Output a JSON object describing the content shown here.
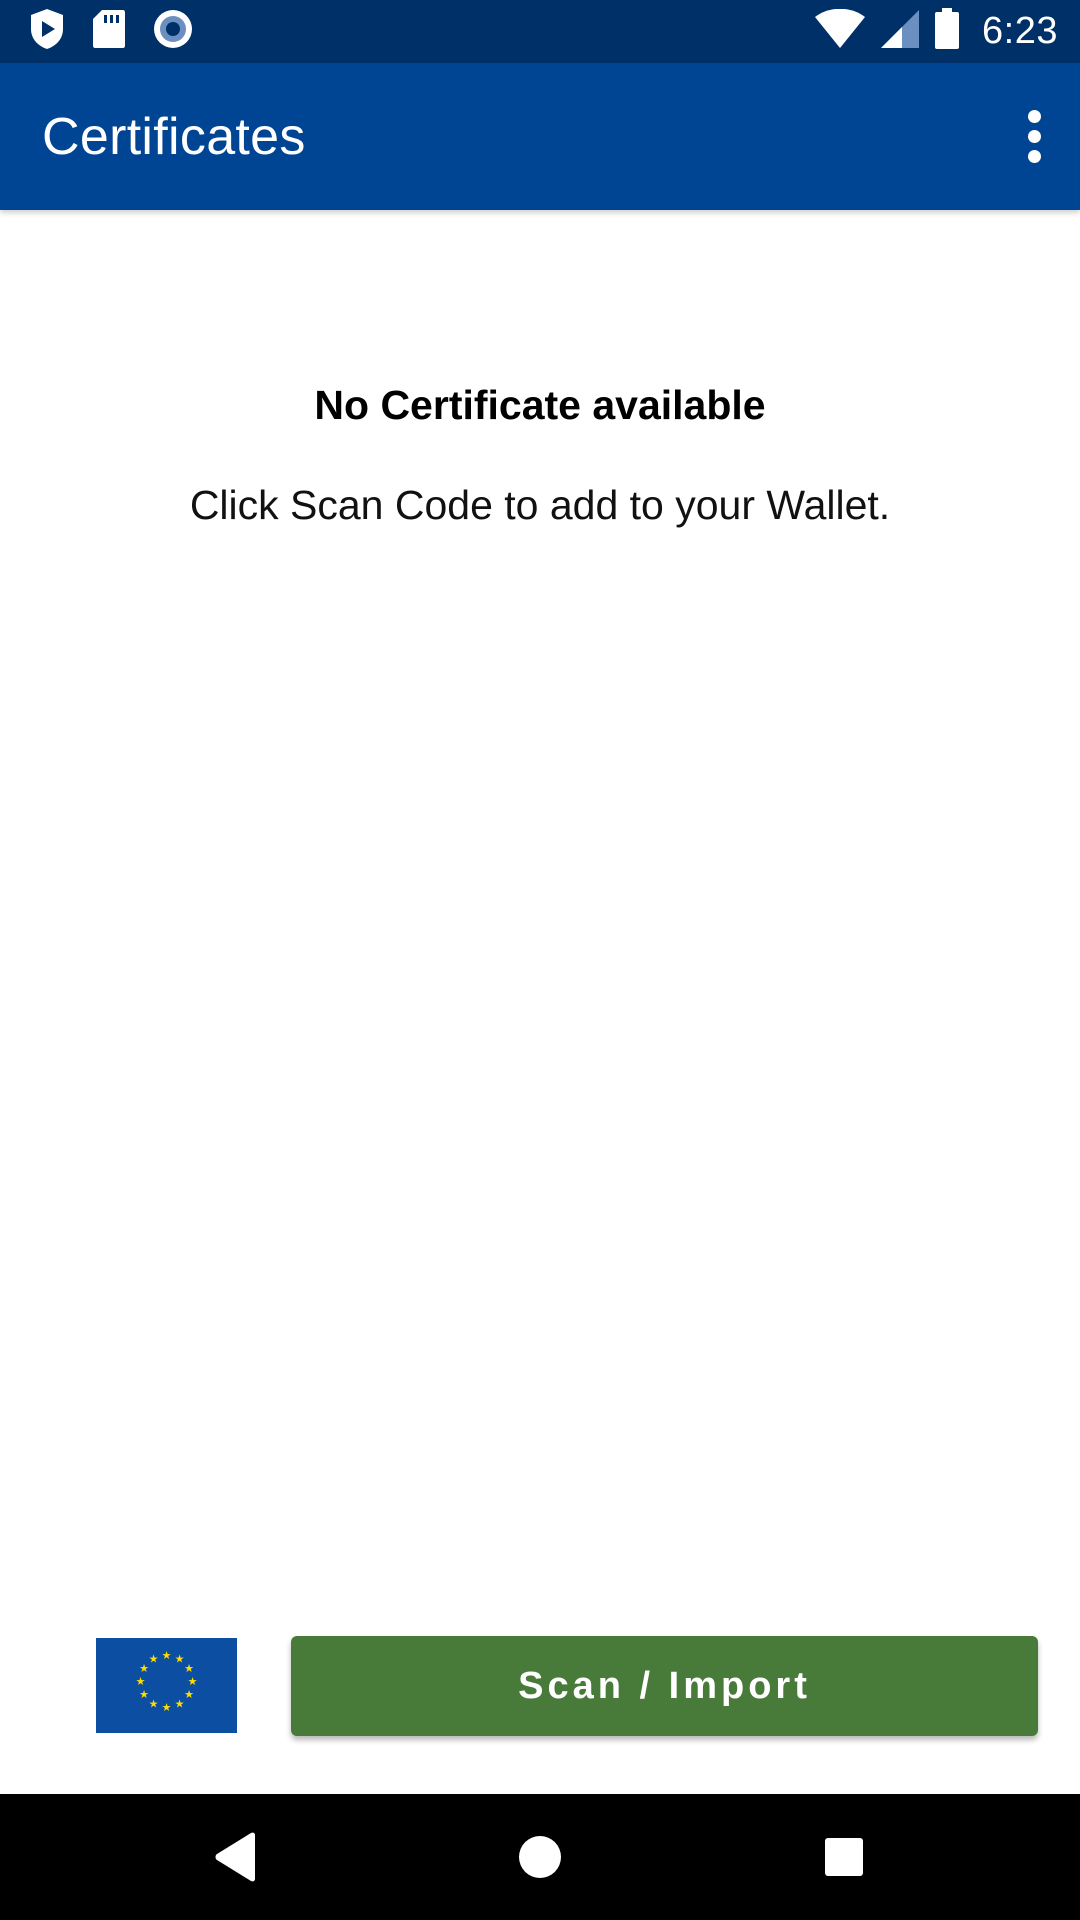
{
  "status_bar": {
    "time": "6:23",
    "left_icons": [
      "play-protect-icon",
      "sd-card-icon",
      "record-icon"
    ],
    "right_icons": [
      "wifi-icon",
      "cell-signal-icon",
      "battery-icon"
    ]
  },
  "app_bar": {
    "title": "Certificates",
    "menu_icon": "more-vert-icon"
  },
  "empty_state": {
    "title": "No Certificate available",
    "message": "Click Scan Code to add to your Wallet."
  },
  "footer": {
    "flag_icon": "eu-flag-icon",
    "scan_button_label": "Scan / Import"
  },
  "nav_bar": {
    "icons": [
      "back-icon",
      "home-icon",
      "recents-icon"
    ]
  },
  "colors": {
    "status_bar": "#003068",
    "app_bar": "#004494",
    "scan_button": "#487a39",
    "flag_blue": "#0b4ea2",
    "flag_stars": "#ffdd00"
  }
}
